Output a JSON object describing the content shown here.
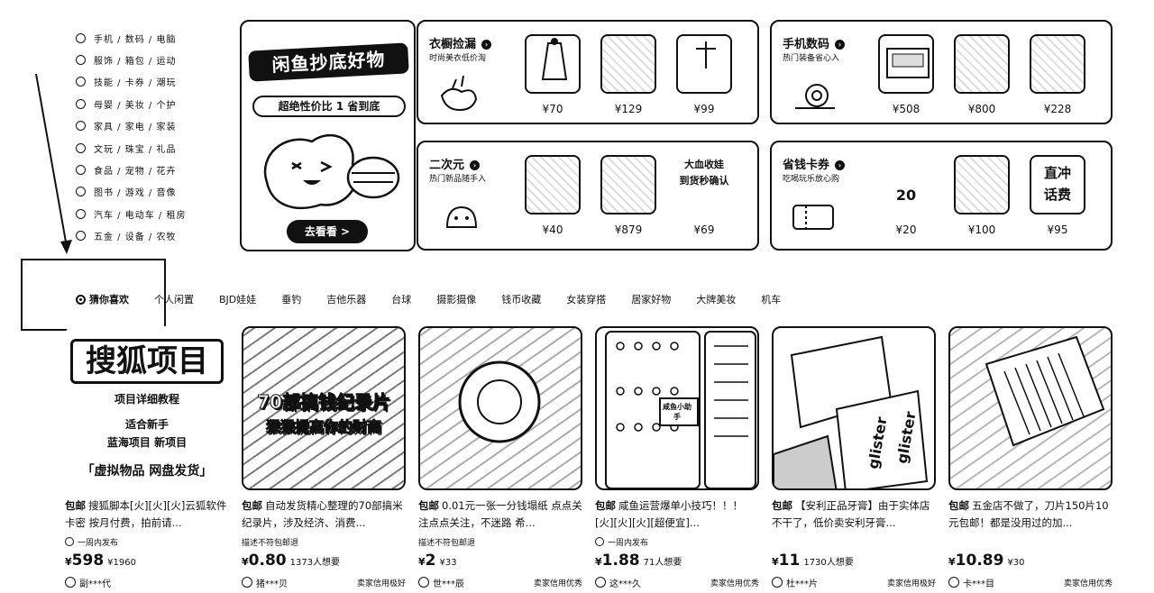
{
  "categories": [
    {
      "icon": "phone-icon",
      "label": "手机 / 数码 / 电脑"
    },
    {
      "icon": "clothes-icon",
      "label": "服饰 / 箱包 / 运动"
    },
    {
      "icon": "toy-icon",
      "label": "技能 / 卡券 / 潮玩"
    },
    {
      "icon": "baby-icon",
      "label": "母婴 / 美妆 / 个护"
    },
    {
      "icon": "home-icon",
      "label": "家具 / 家电 / 家装"
    },
    {
      "icon": "culture-icon",
      "label": "文玩 / 珠宝 / 礼品"
    },
    {
      "icon": "food-icon",
      "label": "食品 / 宠物 / 花卉"
    },
    {
      "icon": "book-icon",
      "label": "图书 / 游戏 / 音像"
    },
    {
      "icon": "car-icon",
      "label": "汽车 / 电动车 / 租房"
    },
    {
      "icon": "tool-icon",
      "label": "五金 / 设备 / 农牧"
    }
  ],
  "banner": {
    "title": "闲鱼抄底好物",
    "subtitle": "超绝性价比 1 省到底",
    "button": "去看看 >"
  },
  "cards": [
    {
      "title": "衣橱捡漏",
      "subtitle": "时尚美衣低价淘",
      "prices": [
        "¥70",
        "¥129",
        "¥99"
      ],
      "thumb_texts": [
        "",
        "",
        ""
      ]
    },
    {
      "title": "手机数码",
      "subtitle": "热门装备省心入",
      "prices": [
        "¥508",
        "¥800",
        "¥228"
      ],
      "thumb_texts": [
        "",
        "",
        ""
      ]
    },
    {
      "title": "二次元",
      "subtitle": "热门新品随手入",
      "prices": [
        "¥40",
        "¥879",
        "¥69"
      ],
      "thumb_texts": [
        "",
        "",
        "大血收娃\n到货秒确认"
      ]
    },
    {
      "title": "省钱卡券",
      "subtitle": "吃喝玩乐放心购",
      "prices": [
        "¥20",
        "¥100",
        "¥95"
      ],
      "thumb_texts": [
        "20",
        "",
        "直冲\n话费"
      ]
    }
  ],
  "tabs": [
    "猜你喜欢",
    "个人闲置",
    "BJD娃娃",
    "垂钓",
    "吉他乐器",
    "台球",
    "摄影摄像",
    "钱币收藏",
    "女装穿搭",
    "居家好物",
    "大牌美妆",
    "机车"
  ],
  "products": [
    {
      "image_text": [
        "搜狐项目",
        "项目详细教程",
        "适合新手",
        "蓝海项目 新项目",
        "「虚拟物品 网盘发货」"
      ],
      "tag": "包邮",
      "title": "搜狐脚本[火][火][火]云狐软件卡密 按月付费，拍前请...",
      "meta": "一周内发布",
      "meta_icon": true,
      "price": "598",
      "wants": "¥1960",
      "seller": "副***代",
      "credit": ""
    },
    {
      "image_text": [
        "70部搞钱纪录片",
        "狠狠提高你的财商"
      ],
      "tag": "包邮",
      "title": "自动发货精心整理的70部搞米纪录片，涉及经济、消费...",
      "meta": "描述不符包邮退",
      "meta_icon": false,
      "price": "0.80",
      "wants": "1373人想要",
      "seller": "猪***贝",
      "credit": "卖家信用极好"
    },
    {
      "image_text": [],
      "tag": "包邮",
      "title": "0.01元一张一分钱塌纸 点点关注点点关注，不迷路 希...",
      "meta": "描述不符包邮退",
      "meta_icon": false,
      "price": "2",
      "wants": "¥33",
      "seller": "世***辰",
      "credit": "卖家信用优秀"
    },
    {
      "image_text": [
        "咸鱼小助手"
      ],
      "tag": "包邮",
      "title": "咸鱼运营爆单小技巧！！！[火][火][火][超便宜]...",
      "meta": "一周内发布",
      "meta_icon": true,
      "price": "1.88",
      "wants": "71人想要",
      "seller": "这***久",
      "credit": "卖家信用优秀"
    },
    {
      "image_text": [
        "glister",
        "glister"
      ],
      "tag": "包邮",
      "title": "【安利正品牙膏】由于实体店不干了，低价卖安利牙膏...",
      "meta": "",
      "meta_icon": false,
      "price": "11",
      "wants": "1730人想要",
      "seller": "杜***片",
      "credit": "卖家信用极好"
    },
    {
      "image_text": [],
      "tag": "包邮",
      "title": "五金店不做了，刀片150片10元包邮！都是没用过的加...",
      "meta": "",
      "meta_icon": false,
      "price": "10.89",
      "wants": "¥30",
      "seller": "卡***目",
      "credit": "卖家信用优秀"
    }
  ]
}
